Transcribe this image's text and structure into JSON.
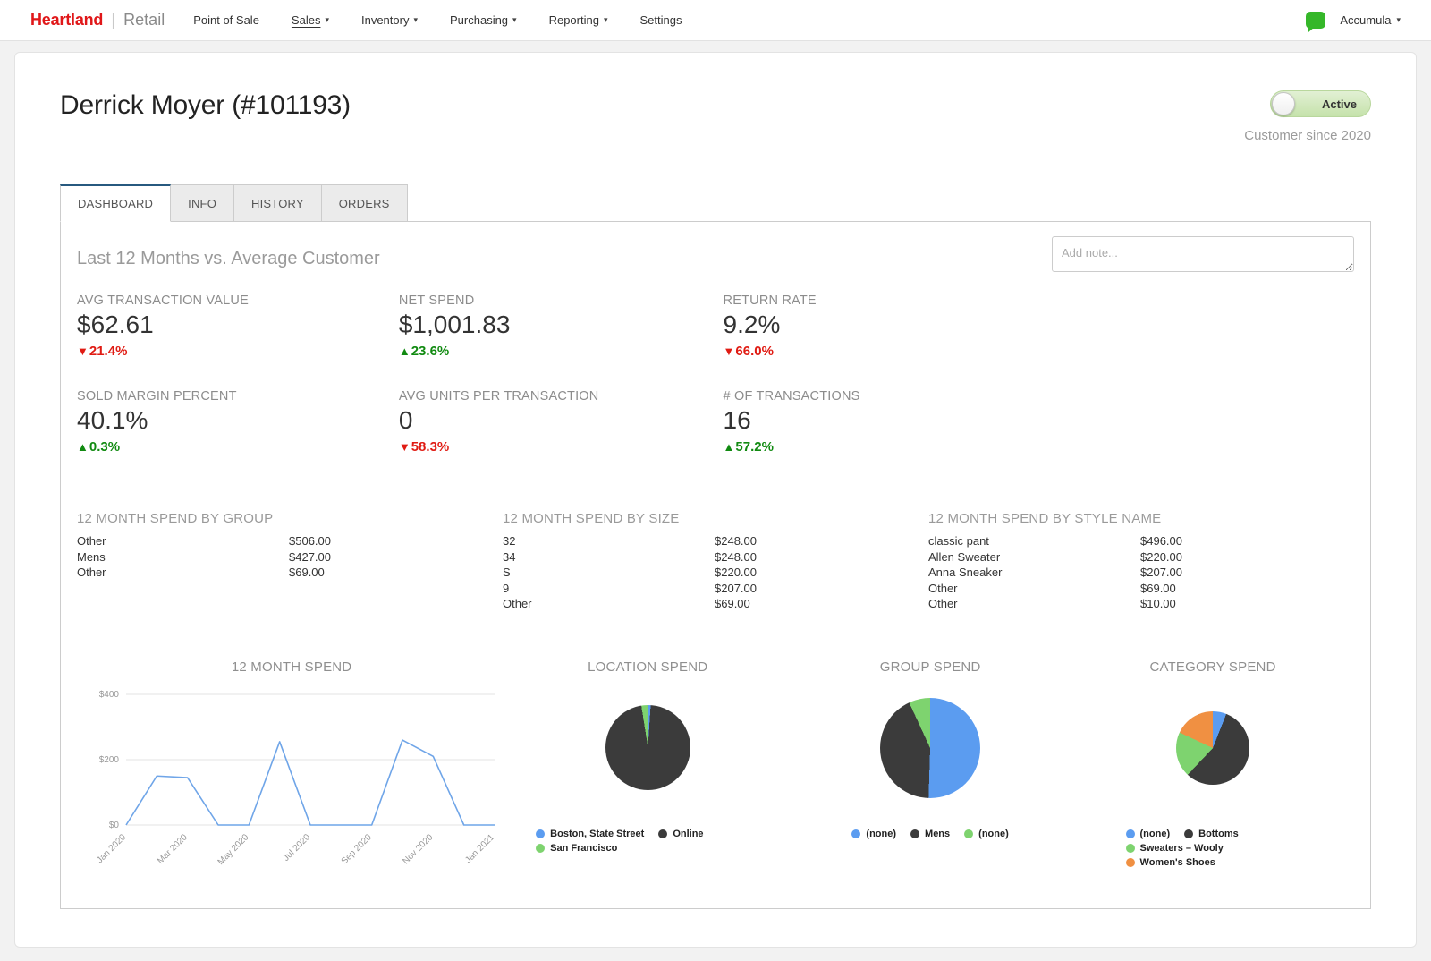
{
  "nav": {
    "brand": {
      "primary": "Heartland",
      "sep": "|",
      "secondary": "Retail"
    },
    "items": [
      {
        "label": "Point of Sale",
        "dropdown": false,
        "active": false
      },
      {
        "label": "Sales",
        "dropdown": true,
        "active": true
      },
      {
        "label": "Inventory",
        "dropdown": true,
        "active": false
      },
      {
        "label": "Purchasing",
        "dropdown": true,
        "active": false
      },
      {
        "label": "Reporting",
        "dropdown": true,
        "active": false
      },
      {
        "label": "Settings",
        "dropdown": false,
        "active": false
      }
    ],
    "account": "Accumula"
  },
  "customer": {
    "title": "Derrick Moyer (#101193)",
    "status": "Active",
    "since": "Customer since 2020"
  },
  "tabs": [
    {
      "label": "DASHBOARD",
      "active": true
    },
    {
      "label": "INFO",
      "active": false
    },
    {
      "label": "HISTORY",
      "active": false
    },
    {
      "label": "ORDERS",
      "active": false
    }
  ],
  "panel": {
    "heading": "Last 12 Months vs. Average Customer",
    "note_placeholder": "Add note..."
  },
  "metrics": [
    {
      "label": "AVG TRANSACTION VALUE",
      "value": "$62.61",
      "delta": "21.4%",
      "direction": "down"
    },
    {
      "label": "NET SPEND",
      "value": "$1,001.83",
      "delta": "23.6%",
      "direction": "up"
    },
    {
      "label": "RETURN RATE",
      "value": "9.2%",
      "delta": "66.0%",
      "direction": "down"
    },
    {
      "label": "SOLD MARGIN PERCENT",
      "value": "40.1%",
      "delta": "0.3%",
      "direction": "up"
    },
    {
      "label": "AVG UNITS PER TRANSACTION",
      "value": "0",
      "delta": "58.3%",
      "direction": "down"
    },
    {
      "label": "# OF TRANSACTIONS",
      "value": "16",
      "delta": "57.2%",
      "direction": "up"
    }
  ],
  "spend_tables": [
    {
      "title": "12 MONTH SPEND BY GROUP",
      "rows": [
        {
          "label": "Other",
          "value": "$506.00"
        },
        {
          "label": "Mens",
          "value": "$427.00"
        },
        {
          "label": "Other",
          "value": "$69.00"
        }
      ]
    },
    {
      "title": "12 MONTH SPEND BY SIZE",
      "rows": [
        {
          "label": "32",
          "value": "$248.00"
        },
        {
          "label": "34",
          "value": "$248.00"
        },
        {
          "label": "S",
          "value": "$220.00"
        },
        {
          "label": "9",
          "value": "$207.00"
        },
        {
          "label": "Other",
          "value": "$69.00"
        }
      ]
    },
    {
      "title": "12 MONTH SPEND BY STYLE NAME",
      "rows": [
        {
          "label": "classic pant",
          "value": "$496.00"
        },
        {
          "label": "Allen Sweater",
          "value": "$220.00"
        },
        {
          "label": "Anna Sneaker",
          "value": "$207.00"
        },
        {
          "label": "Other",
          "value": "$69.00"
        },
        {
          "label": "Other",
          "value": "$10.00"
        }
      ]
    }
  ],
  "chart_data": [
    {
      "type": "line",
      "title": "12 MONTH SPEND",
      "x": [
        "Jan 2020",
        "Feb 2020",
        "Mar 2020",
        "Apr 2020",
        "May 2020",
        "Jun 2020",
        "Jul 2020",
        "Aug 2020",
        "Sep 2020",
        "Oct 2020",
        "Nov 2020",
        "Dec 2020",
        "Jan 2021"
      ],
      "values": [
        0,
        150,
        145,
        0,
        0,
        255,
        0,
        0,
        0,
        260,
        210,
        0,
        0
      ],
      "ylim": [
        0,
        400
      ],
      "yticks": [
        [
          0,
          "$0"
        ],
        [
          200,
          "$200"
        ],
        [
          400,
          "$400"
        ]
      ],
      "xtick_every": 2,
      "line_color": "#6fa5e8",
      "grid": true,
      "xlabel": "",
      "ylabel": ""
    },
    {
      "type": "pie",
      "title": "LOCATION SPEND",
      "size": 95,
      "slices": [
        {
          "label": "Boston, State Street",
          "value": 1,
          "color": "#5b9cf0"
        },
        {
          "label": "Online",
          "value": 96.5,
          "color": "#3b3b3b"
        },
        {
          "label": "San Francisco",
          "value": 2.5,
          "color": "#7ed36f"
        }
      ],
      "legend_position": "bottom"
    },
    {
      "type": "pie",
      "title": "GROUP SPEND",
      "size": 112,
      "slices": [
        {
          "label": "(none)",
          "value": 506,
          "color": "#5b9cf0"
        },
        {
          "label": "Mens",
          "value": 427,
          "color": "#3b3b3b"
        },
        {
          "label": "(none)",
          "value": 69,
          "color": "#7ed36f"
        }
      ],
      "legend_position": "bottom"
    },
    {
      "type": "pie",
      "title": "CATEGORY SPEND",
      "size": 82,
      "slices": [
        {
          "label": "(none)",
          "value": 6,
          "color": "#5b9cf0"
        },
        {
          "label": "Bottoms",
          "value": 56,
          "color": "#3b3b3b"
        },
        {
          "label": "Sweaters – Wooly",
          "value": 20,
          "color": "#7ed36f"
        },
        {
          "label": "Women's Shoes",
          "value": 18,
          "color": "#f09042"
        }
      ],
      "legend_position": "bottom"
    }
  ]
}
